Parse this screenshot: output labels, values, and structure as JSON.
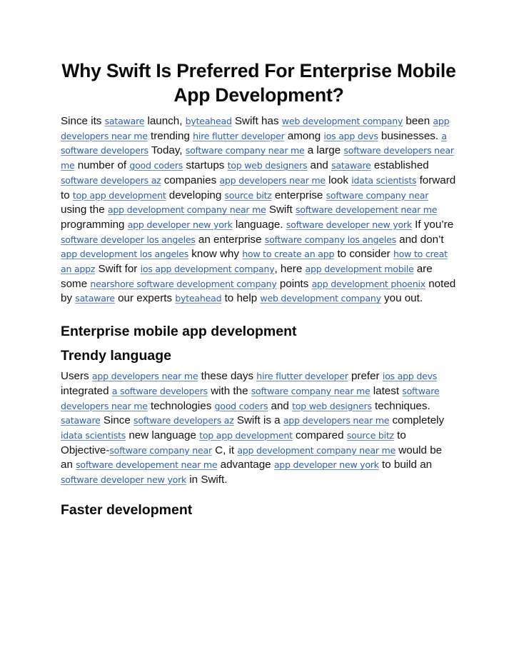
{
  "document": {
    "title": "Why Swift Is Preferred For Enterprise Mobile App Development?",
    "link_color": "#2f5fb3",
    "intro_paragraph": [
      {
        "t": "Since its "
      },
      {
        "l": "sataware"
      },
      {
        "t": " launch, "
      },
      {
        "l": "byteahead"
      },
      {
        "t": " Swift has "
      },
      {
        "l": "web development company"
      },
      {
        "t": " been "
      },
      {
        "l": "app developers near me"
      },
      {
        "t": " trending "
      },
      {
        "l": "hire flutter developer"
      },
      {
        "t": " among "
      },
      {
        "l": "ios app devs"
      },
      {
        "t": " businesses. "
      },
      {
        "l": "a software developers"
      },
      {
        "t": " Today, "
      },
      {
        "l": "software company near me"
      },
      {
        "t": " a large "
      },
      {
        "l": "software developers near me"
      },
      {
        "t": " number of "
      },
      {
        "l": "good coders"
      },
      {
        "t": " startups "
      },
      {
        "l": "top web designers"
      },
      {
        "t": " and "
      },
      {
        "l": "sataware"
      },
      {
        "t": " established "
      },
      {
        "l": "software developers az"
      },
      {
        "t": " companies "
      },
      {
        "l": "app developers near me"
      },
      {
        "t": " look "
      },
      {
        "l": "idata scientists"
      },
      {
        "t": " forward to "
      },
      {
        "l": "top app development"
      },
      {
        "t": " developing "
      },
      {
        "l": "source bitz"
      },
      {
        "t": " enterprise "
      },
      {
        "l": "software company near"
      },
      {
        "t": " using the "
      },
      {
        "l": "app development company near me"
      },
      {
        "t": " Swift "
      },
      {
        "l": "software developement near me"
      },
      {
        "t": " programming "
      },
      {
        "l": "app developer new york"
      },
      {
        "t": " language. "
      },
      {
        "l": "software developer new york"
      },
      {
        "t": " If you’re "
      },
      {
        "l": "software developer los angeles"
      },
      {
        "t": " an enterprise "
      },
      {
        "l": "software company los angeles"
      },
      {
        "t": " and don’t "
      },
      {
        "l": "app development los angeles"
      },
      {
        "t": " know why "
      },
      {
        "l": "how to create an app"
      },
      {
        "t": " to consider "
      },
      {
        "l": "how to creat an appz"
      },
      {
        "t": " Swift for "
      },
      {
        "l": "ios app development company"
      },
      {
        "t": ", here "
      },
      {
        "l": "app development mobile"
      },
      {
        "t": " are some "
      },
      {
        "l": "nearshore software development company"
      },
      {
        "t": " points "
      },
      {
        "l": "app development phoenix"
      },
      {
        "t": " noted by "
      },
      {
        "l": "sataware"
      },
      {
        "t": " our experts "
      },
      {
        "l": "byteahead"
      },
      {
        "t": " to help "
      },
      {
        "l": "web development company"
      },
      {
        "t": " you out."
      }
    ],
    "heading_1": "Enterprise mobile app development",
    "heading_2": "Trendy language",
    "trendy_paragraph": [
      {
        "t": "Users "
      },
      {
        "l": "app developers near me"
      },
      {
        "t": " these days "
      },
      {
        "l": "hire flutter developer"
      },
      {
        "t": " prefer "
      },
      {
        "l": "ios app devs"
      },
      {
        "t": " integrated "
      },
      {
        "l": "a software developers"
      },
      {
        "t": " with the "
      },
      {
        "l": "software company near me"
      },
      {
        "t": " latest "
      },
      {
        "l": "software developers near me"
      },
      {
        "t": " technologies "
      },
      {
        "l": "good coders"
      },
      {
        "t": " and "
      },
      {
        "l": "top web designers"
      },
      {
        "t": " techniques. "
      },
      {
        "l": "sataware"
      },
      {
        "t": " Since "
      },
      {
        "l": "software developers az"
      },
      {
        "t": " Swift is a "
      },
      {
        "l": "app developers near me"
      },
      {
        "t": " completely "
      },
      {
        "l": "idata scientists"
      },
      {
        "t": " new language "
      },
      {
        "l": "top app development"
      },
      {
        "t": " compared "
      },
      {
        "l": "source bitz"
      },
      {
        "t": " to Objective-"
      },
      {
        "l": "software company near"
      },
      {
        "t": " C, it "
      },
      {
        "l": "app development company near me"
      },
      {
        "t": " would be an "
      },
      {
        "l": "software developement near me"
      },
      {
        "t": " advantage "
      },
      {
        "l": "app developer new york"
      },
      {
        "t": " to build an "
      },
      {
        "l": "software developer new york"
      },
      {
        "t": " in Swift."
      }
    ],
    "heading_3": "Faster development"
  }
}
